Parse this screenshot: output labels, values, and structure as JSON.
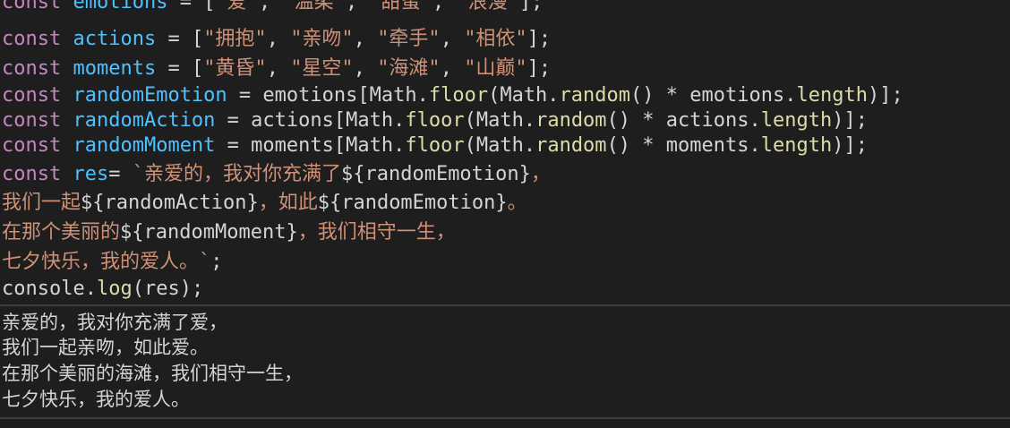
{
  "code": {
    "lines": [
      [
        {
          "cls": "k",
          "text": "const"
        },
        {
          "cls": "p",
          "text": " "
        },
        {
          "cls": "v",
          "text": "emotions"
        },
        {
          "cls": "p",
          "text": " = ["
        },
        {
          "cls": "s",
          "text": "\"爱\""
        },
        {
          "cls": "p",
          "text": ", "
        },
        {
          "cls": "s",
          "text": "\"温柔\""
        },
        {
          "cls": "p",
          "text": ", "
        },
        {
          "cls": "s",
          "text": "\"甜蜜\""
        },
        {
          "cls": "p",
          "text": ", "
        },
        {
          "cls": "s",
          "text": "\"浪漫\""
        },
        {
          "cls": "p",
          "text": "];"
        }
      ],
      [
        {
          "cls": "k",
          "text": "const"
        },
        {
          "cls": "p",
          "text": " "
        },
        {
          "cls": "v",
          "text": "actions"
        },
        {
          "cls": "p",
          "text": " = ["
        },
        {
          "cls": "s",
          "text": "\"拥抱\""
        },
        {
          "cls": "p",
          "text": ", "
        },
        {
          "cls": "s",
          "text": "\"亲吻\""
        },
        {
          "cls": "p",
          "text": ", "
        },
        {
          "cls": "s",
          "text": "\"牵手\""
        },
        {
          "cls": "p",
          "text": ", "
        },
        {
          "cls": "s",
          "text": "\"相依\""
        },
        {
          "cls": "p",
          "text": "];"
        }
      ],
      [
        {
          "cls": "k",
          "text": "const"
        },
        {
          "cls": "p",
          "text": " "
        },
        {
          "cls": "v",
          "text": "moments"
        },
        {
          "cls": "p",
          "text": " = ["
        },
        {
          "cls": "s",
          "text": "\"黄昏\""
        },
        {
          "cls": "p",
          "text": ", "
        },
        {
          "cls": "s",
          "text": "\"星空\""
        },
        {
          "cls": "p",
          "text": ", "
        },
        {
          "cls": "s",
          "text": "\"海滩\""
        },
        {
          "cls": "p",
          "text": ", "
        },
        {
          "cls": "s",
          "text": "\"山巅\""
        },
        {
          "cls": "p",
          "text": "];"
        }
      ],
      [
        {
          "cls": "k",
          "text": "const"
        },
        {
          "cls": "p",
          "text": " "
        },
        {
          "cls": "v",
          "text": "randomEmotion"
        },
        {
          "cls": "p",
          "text": " = emotions[Math."
        },
        {
          "cls": "f",
          "text": "floor"
        },
        {
          "cls": "p",
          "text": "(Math."
        },
        {
          "cls": "f",
          "text": "random"
        },
        {
          "cls": "p",
          "text": "() * emotions."
        },
        {
          "cls": "f",
          "text": "length"
        },
        {
          "cls": "p",
          "text": ")];"
        }
      ],
      [
        {
          "cls": "k",
          "text": "const"
        },
        {
          "cls": "p",
          "text": " "
        },
        {
          "cls": "v",
          "text": "randomAction"
        },
        {
          "cls": "p",
          "text": " = actions[Math."
        },
        {
          "cls": "f",
          "text": "floor"
        },
        {
          "cls": "p",
          "text": "(Math."
        },
        {
          "cls": "f",
          "text": "random"
        },
        {
          "cls": "p",
          "text": "() * actions."
        },
        {
          "cls": "f",
          "text": "length"
        },
        {
          "cls": "p",
          "text": ")];"
        }
      ],
      [
        {
          "cls": "k",
          "text": "const"
        },
        {
          "cls": "p",
          "text": " "
        },
        {
          "cls": "v",
          "text": "randomMoment"
        },
        {
          "cls": "p",
          "text": " = moments[Math."
        },
        {
          "cls": "f",
          "text": "floor"
        },
        {
          "cls": "p",
          "text": "(Math."
        },
        {
          "cls": "f",
          "text": "random"
        },
        {
          "cls": "p",
          "text": "() * moments."
        },
        {
          "cls": "f",
          "text": "length"
        },
        {
          "cls": "p",
          "text": ")];"
        }
      ],
      [
        {
          "cls": "k",
          "text": "const"
        },
        {
          "cls": "p",
          "text": " "
        },
        {
          "cls": "v",
          "text": "res"
        },
        {
          "cls": "p",
          "text": "= "
        },
        {
          "cls": "s",
          "text": "`亲爱的，我对你充满了"
        },
        {
          "cls": "p",
          "text": "${randomEmotion}"
        },
        {
          "cls": "s",
          "text": "，"
        }
      ],
      [
        {
          "cls": "s",
          "text": "我们一起"
        },
        {
          "cls": "p",
          "text": "${randomAction}"
        },
        {
          "cls": "s",
          "text": "，如此"
        },
        {
          "cls": "p",
          "text": "${randomEmotion}"
        },
        {
          "cls": "s",
          "text": "。"
        }
      ],
      [
        {
          "cls": "s",
          "text": "在那个美丽的"
        },
        {
          "cls": "p",
          "text": "${randomMoment}"
        },
        {
          "cls": "s",
          "text": "，我们相守一生，"
        }
      ],
      [
        {
          "cls": "s",
          "text": "七夕快乐，我的爱人。`"
        },
        {
          "cls": "p",
          "text": ";"
        }
      ],
      [
        {
          "cls": "p",
          "text": "console."
        },
        {
          "cls": "f",
          "text": "log"
        },
        {
          "cls": "p",
          "text": "(res);"
        }
      ]
    ]
  },
  "output": {
    "lines": [
      "亲爱的，我对你充满了爱，",
      "我们一起亲吻，如此爱。",
      "在那个美丽的海滩，我们相守一生，",
      "七夕快乐，我的爱人。"
    ]
  },
  "colors": {
    "background": "#1e1e1e",
    "keyword": "#c586c0",
    "variable": "#4fc1ff",
    "string": "#ce9178",
    "function": "#dcdcaa",
    "plain": "#d4d4d4"
  }
}
